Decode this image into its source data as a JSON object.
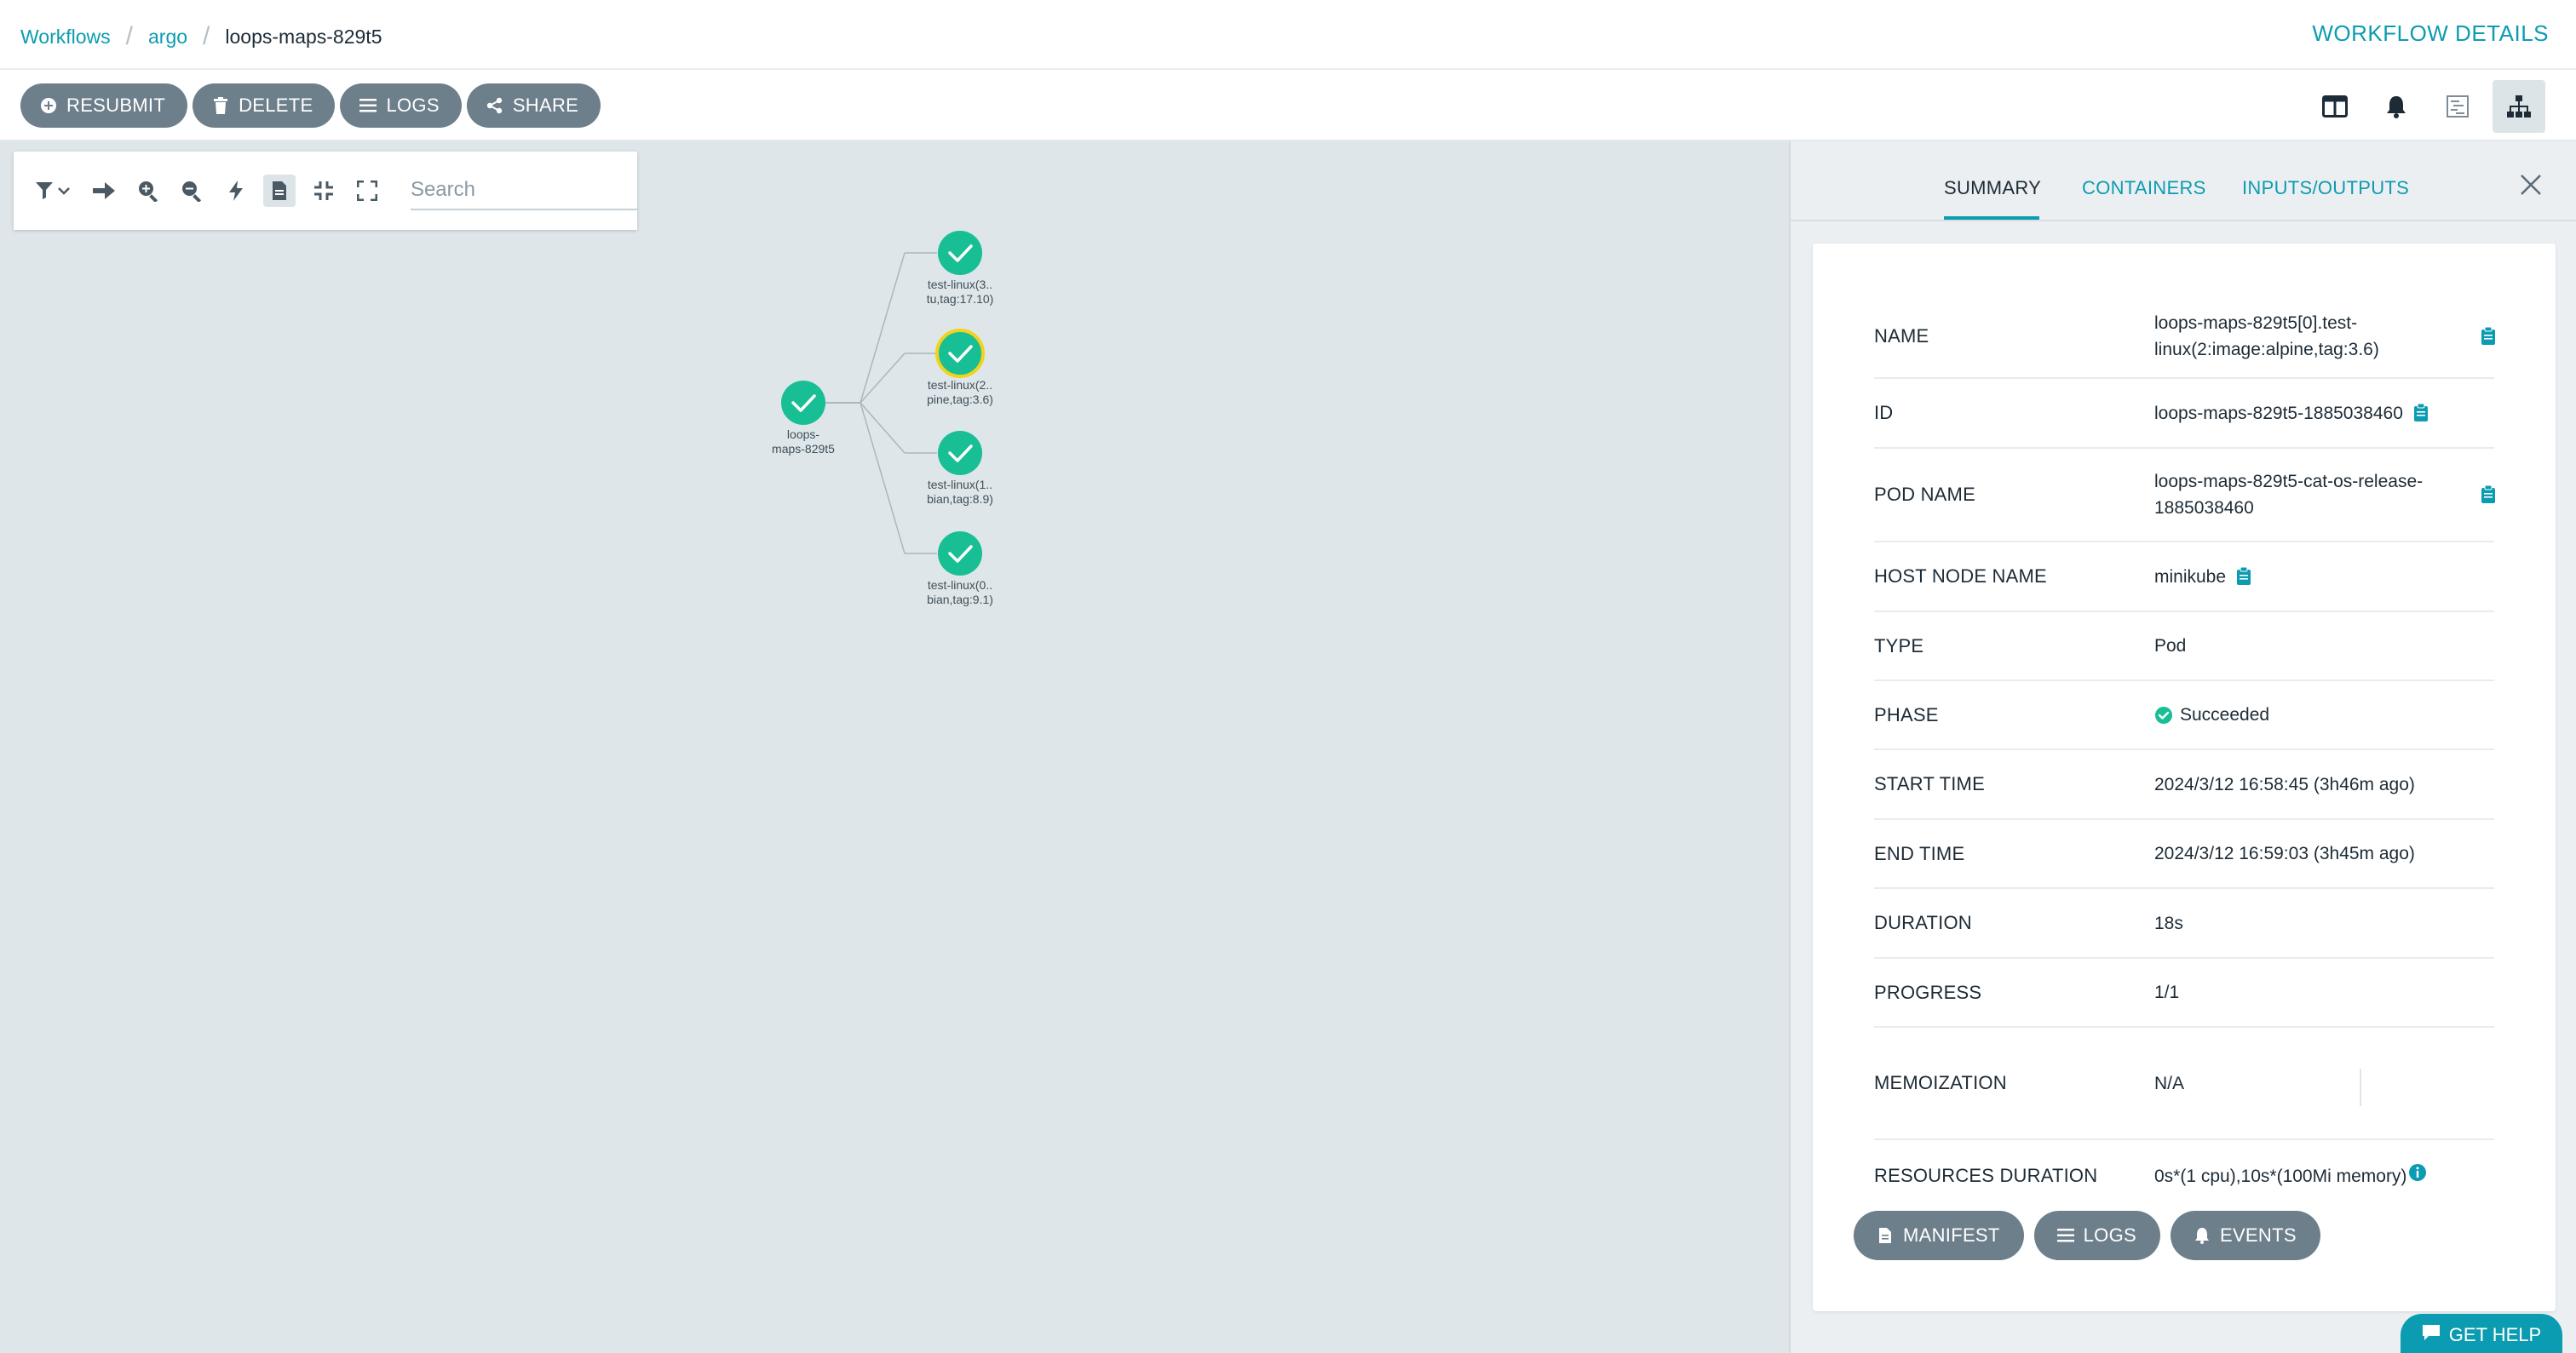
{
  "breadcrumb": {
    "items": [
      {
        "label": "Workflows"
      },
      {
        "label": "argo"
      }
    ],
    "current": "loops-maps-829t5"
  },
  "header": {
    "title": "WORKFLOW DETAILS"
  },
  "toolbar": {
    "buttons": [
      {
        "label": "RESUBMIT",
        "icon": "plus-circle-icon"
      },
      {
        "label": "DELETE",
        "icon": "trash-icon"
      },
      {
        "label": "LOGS",
        "icon": "list-icon"
      },
      {
        "label": "SHARE",
        "icon": "share-icon"
      }
    ],
    "view_buttons": [
      {
        "icon": "columns-icon"
      },
      {
        "icon": "bell-icon"
      },
      {
        "icon": "timeline-icon"
      },
      {
        "icon": "sitemap-icon",
        "active": true
      }
    ]
  },
  "graph": {
    "search_placeholder": "Search",
    "tools": [
      {
        "icon": "filter-icon"
      },
      {
        "icon": "arrow-right-icon"
      },
      {
        "icon": "zoom-in-icon"
      },
      {
        "icon": "zoom-out-icon"
      },
      {
        "icon": "bolt-icon"
      },
      {
        "icon": "file-icon",
        "active": true
      },
      {
        "icon": "compress-icon"
      },
      {
        "icon": "expand-icon"
      }
    ],
    "root": {
      "label_line1": "loops-",
      "label_line2": "maps-829t5",
      "status": "succeeded"
    },
    "children": [
      {
        "label_line1": "test-linux(3..",
        "label_line2": "tu,tag:17.10)",
        "status": "succeeded"
      },
      {
        "label_line1": "test-linux(2..",
        "label_line2": "pine,tag:3.6)",
        "status": "succeeded",
        "selected": true
      },
      {
        "label_line1": "test-linux(1..",
        "label_line2": "bian,tag:8.9)",
        "status": "succeeded"
      },
      {
        "label_line1": "test-linux(0..",
        "label_line2": "bian,tag:9.1)",
        "status": "succeeded"
      }
    ]
  },
  "panel": {
    "tabs": [
      {
        "label": "SUMMARY",
        "active": true
      },
      {
        "label": "CONTAINERS"
      },
      {
        "label": "INPUTS/OUTPUTS"
      }
    ],
    "summary": {
      "name": {
        "key": "NAME",
        "line1": "loops-maps-829t5[0].test-",
        "line2": "linux(2:image:alpine,tag:3.6)"
      },
      "id": {
        "key": "ID",
        "value": "loops-maps-829t5-1885038460"
      },
      "pod_name": {
        "key": "POD NAME",
        "line1": "loops-maps-829t5-cat-os-release-",
        "line2": "1885038460"
      },
      "host_node_name": {
        "key": "HOST NODE NAME",
        "value": "minikube"
      },
      "type": {
        "key": "TYPE",
        "value": "Pod"
      },
      "phase": {
        "key": "PHASE",
        "value": "Succeeded"
      },
      "start_time": {
        "key": "START TIME",
        "value": "2024/3/12 16:58:45 (3h46m ago)"
      },
      "end_time": {
        "key": "END TIME",
        "value": "2024/3/12 16:59:03 (3h45m ago)"
      },
      "duration": {
        "key": "DURATION",
        "value": "18s"
      },
      "progress": {
        "key": "PROGRESS",
        "value": "1/1"
      },
      "memoization": {
        "key": "MEMOIZATION",
        "value": "N/A"
      },
      "resources_duration": {
        "key": "RESOURCES DURATION",
        "value": "0s*(1 cpu),10s*(100Mi memory)"
      }
    },
    "actions": [
      {
        "label": "MANIFEST",
        "icon": "file-icon"
      },
      {
        "label": "LOGS",
        "icon": "list-icon"
      },
      {
        "label": "EVENTS",
        "icon": "bell-icon"
      }
    ]
  },
  "help": {
    "label": "GET HELP"
  },
  "colors": {
    "accent": "#0c9cb1",
    "success": "#18be94",
    "selected_ring": "#f2d21b",
    "button": "#6d7f8b",
    "canvas": "#dee6e9"
  }
}
